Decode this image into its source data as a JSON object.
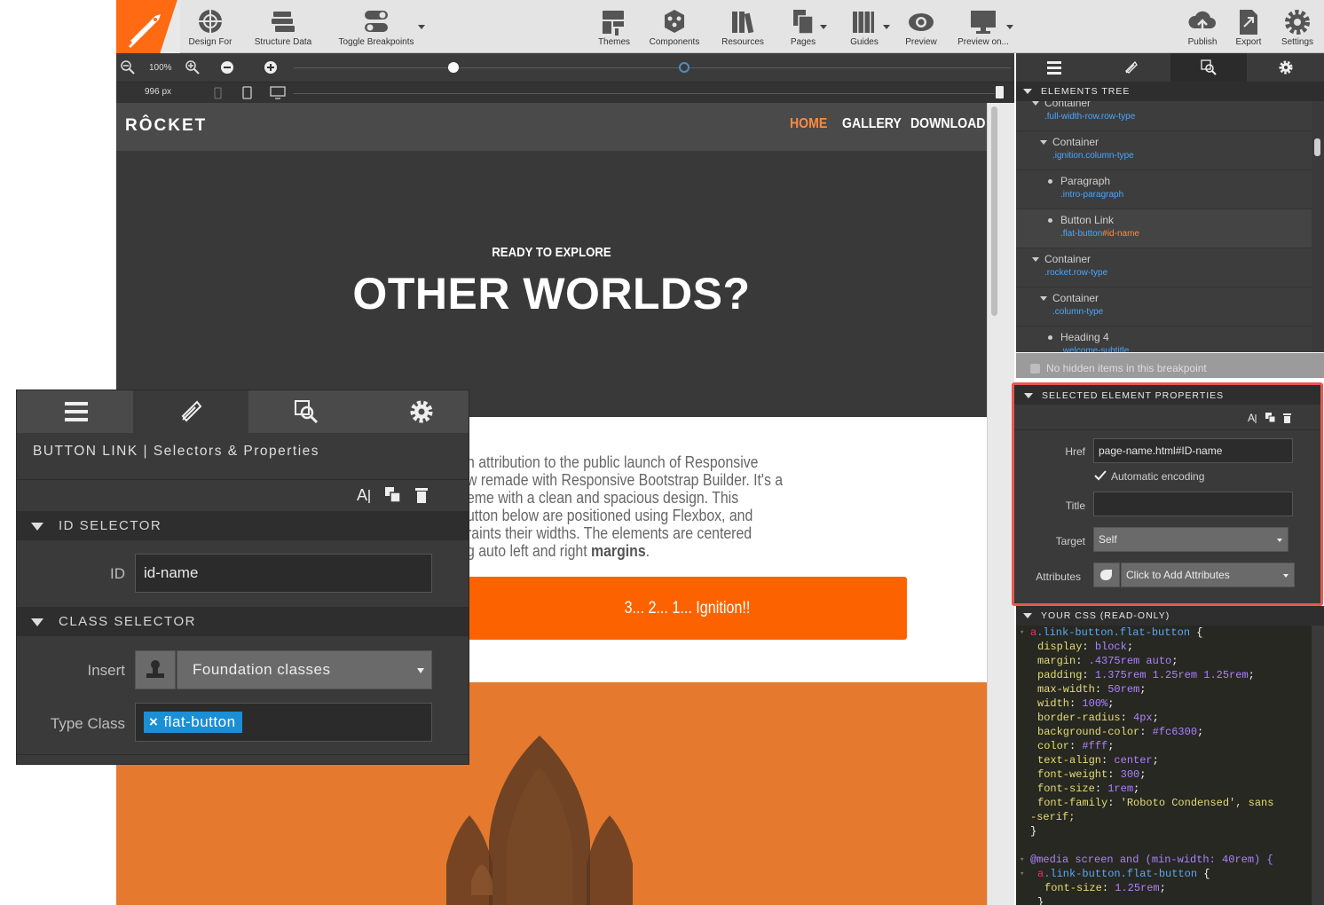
{
  "toolbar": {
    "left_buttons": [
      {
        "label": "Design For",
        "icon": "crosshair-icon"
      },
      {
        "label": "Structure Data",
        "icon": "stack-icon"
      },
      {
        "label": "Toggle Breakpoints",
        "icon": "toggle-icon"
      }
    ],
    "center_buttons": [
      {
        "label": "Themes",
        "icon": "paint-roller-icon"
      },
      {
        "label": "Components",
        "icon": "cubes-icon"
      },
      {
        "label": "Resources",
        "icon": "books-icon"
      },
      {
        "label": "Pages",
        "icon": "pages-icon"
      },
      {
        "label": "Guides",
        "icon": "guides-icon"
      },
      {
        "label": "Preview",
        "icon": "eye-icon"
      },
      {
        "label": "Preview on...",
        "icon": "monitor-icon"
      }
    ],
    "right_buttons": [
      {
        "label": "Publish",
        "icon": "cloud-upload-icon"
      },
      {
        "label": "Export",
        "icon": "export-icon"
      },
      {
        "label": "Settings",
        "icon": "gear-icon"
      }
    ]
  },
  "zoom": {
    "level": "100%",
    "width": "996 px"
  },
  "site": {
    "brand": "RÔCKET",
    "nav": [
      "HOME",
      "GALLERY",
      "DOWNLOAD"
    ],
    "hero_kicker": "READY TO EXPLORE",
    "hero_title": "OTHER WORLDS?",
    "body_lines": [
      "n attribution to the public launch of Responsive",
      "w remade with Responsive Bootstrap Builder. It's a",
      "eme with a clean and spacious design. This",
      "utton below are positioned using Flexbox, and",
      "raints their widths. The elements are centered",
      "g auto left and right "
    ],
    "body_bold": "margins",
    "body_end": ".",
    "cta": "3... 2... 1... Ignition!!",
    "colors": {
      "accent": "#fc6300",
      "nav_active": "#ff8a3d"
    }
  },
  "elements_tree": {
    "title": "ELEMENTS TREE",
    "items": [
      {
        "name": "Container",
        "cls": ".full-width-row.row-type",
        "id": ""
      },
      {
        "name": "Container",
        "cls": ".ignition.column-type",
        "id": ""
      },
      {
        "name": "Paragraph",
        "cls": ".intro-paragraph",
        "id": ""
      },
      {
        "name": "Button Link",
        "cls": ".flat-button",
        "id": "#id-name"
      },
      {
        "name": "Container",
        "cls": ".rocket.row-type",
        "id": ""
      },
      {
        "name": "Container",
        "cls": ".column-type",
        "id": ""
      },
      {
        "name": "Heading 4",
        "cls": ".welcome-subtitle",
        "id": ""
      }
    ],
    "hidden_note": "No hidden items in this breakpoint"
  },
  "properties": {
    "title": "SELECTED ELEMENT PROPERTIES",
    "href_label": "Href",
    "href_value": "page-name.html#ID-name",
    "encoding_label": "Automatic encoding",
    "title_label": "Title",
    "target_label": "Target",
    "target_value": "Self",
    "attributes_label": "Attributes",
    "attributes_value": "Click to Add Attributes"
  },
  "css": {
    "title": "YOUR CSS (READ-ONLY)",
    "selector_tag": "a",
    "selector": ".link-button.flat-button",
    "open_brace": " {",
    "close_brace": "}",
    "rules": [
      {
        "prop": "display",
        "val": "block"
      },
      {
        "prop": "margin",
        "val": ".4375rem auto"
      },
      {
        "prop": "padding",
        "val": "1.375rem 1.25rem 1.25rem"
      },
      {
        "prop": "max-width",
        "val": "50rem"
      },
      {
        "prop": "width",
        "val": "100%"
      },
      {
        "prop": "border-radius",
        "val": "4px"
      },
      {
        "prop": "background-color",
        "val": "#fc6300"
      },
      {
        "prop": "color",
        "val": "#fff"
      },
      {
        "prop": "text-align",
        "val": "center"
      },
      {
        "prop": "font-weight",
        "val": "300"
      },
      {
        "prop": "font-size",
        "val": "1rem"
      },
      {
        "prop": "font-family",
        "val": "'Roboto Condensed', sans"
      }
    ],
    "wrap_tail": "-serif;",
    "media": "@media screen and (min-width: 40rem) {",
    "media_rule": {
      "prop": "font-size",
      "val": "1.25rem"
    },
    "media_close": "}"
  },
  "float_panel": {
    "title": "BUTTON LINK | Selectors & Properties",
    "id_section": "ID SELECTOR",
    "id_label": "ID",
    "id_value": "id-name",
    "class_section": "CLASS SELECTOR",
    "insert_label": "Insert",
    "insert_value": "Foundation classes",
    "type_label": "Type Class",
    "tag_value": "flat-button"
  }
}
